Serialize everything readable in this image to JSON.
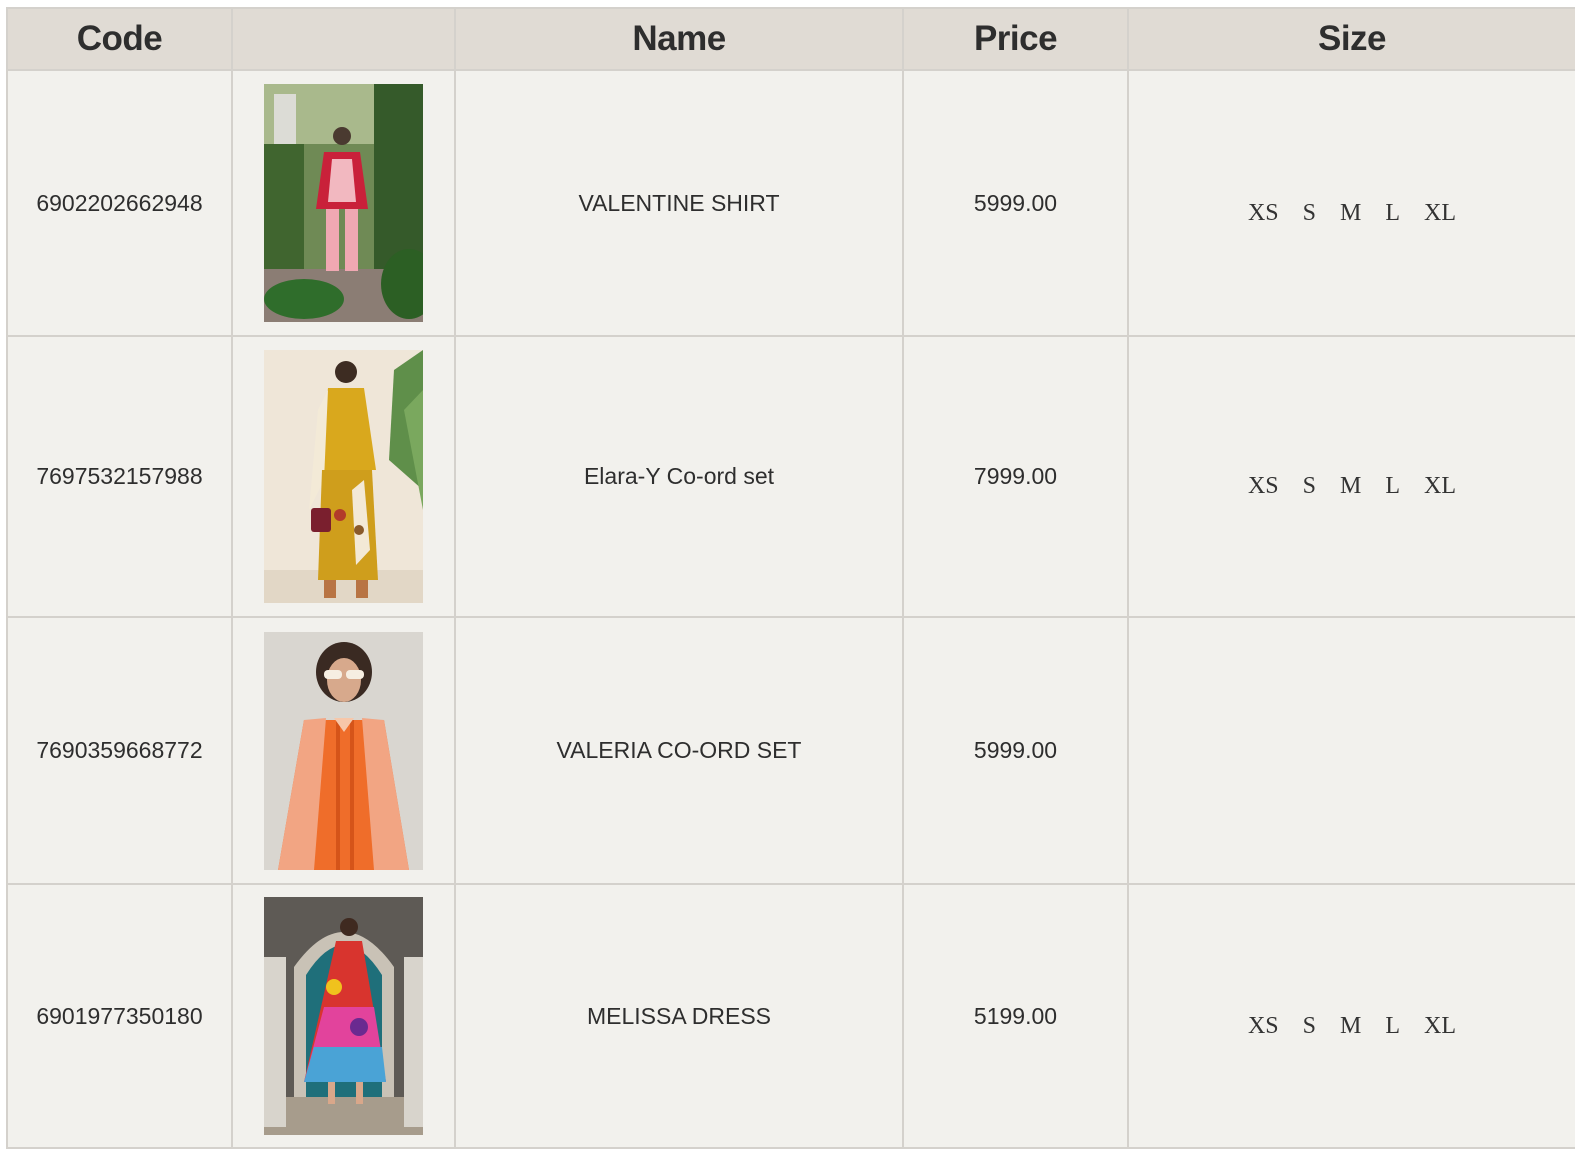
{
  "table": {
    "headers": {
      "code": "Code",
      "image": "",
      "name": "Name",
      "price": "Price",
      "size": "Size"
    },
    "rows": [
      {
        "code": "6902202662948",
        "image_icon": "product-photo",
        "name": "VALENTINE SHIRT",
        "price": "5999.00",
        "sizes": [
          "XS",
          "S",
          "M",
          "L",
          "XL"
        ]
      },
      {
        "code": "7697532157988",
        "image_icon": "product-photo",
        "name": "Elara-Y Co-ord set",
        "price": "7999.00",
        "sizes": [
          "XS",
          "S",
          "M",
          "L",
          "XL"
        ]
      },
      {
        "code": "7690359668772",
        "image_icon": "product-photo",
        "name": "VALERIA CO-ORD SET",
        "price": "5999.00",
        "sizes": []
      },
      {
        "code": "6901977350180",
        "image_icon": "product-photo",
        "name": "MELISSA DRESS",
        "price": "5199.00",
        "sizes": [
          "XS",
          "S",
          "M",
          "L",
          "XL"
        ]
      }
    ]
  },
  "colors": {
    "header_bg": "#e0dbd4",
    "cell_bg": "#f2f1ed",
    "border": "#d4d1cc",
    "text": "#2e2e2e"
  }
}
